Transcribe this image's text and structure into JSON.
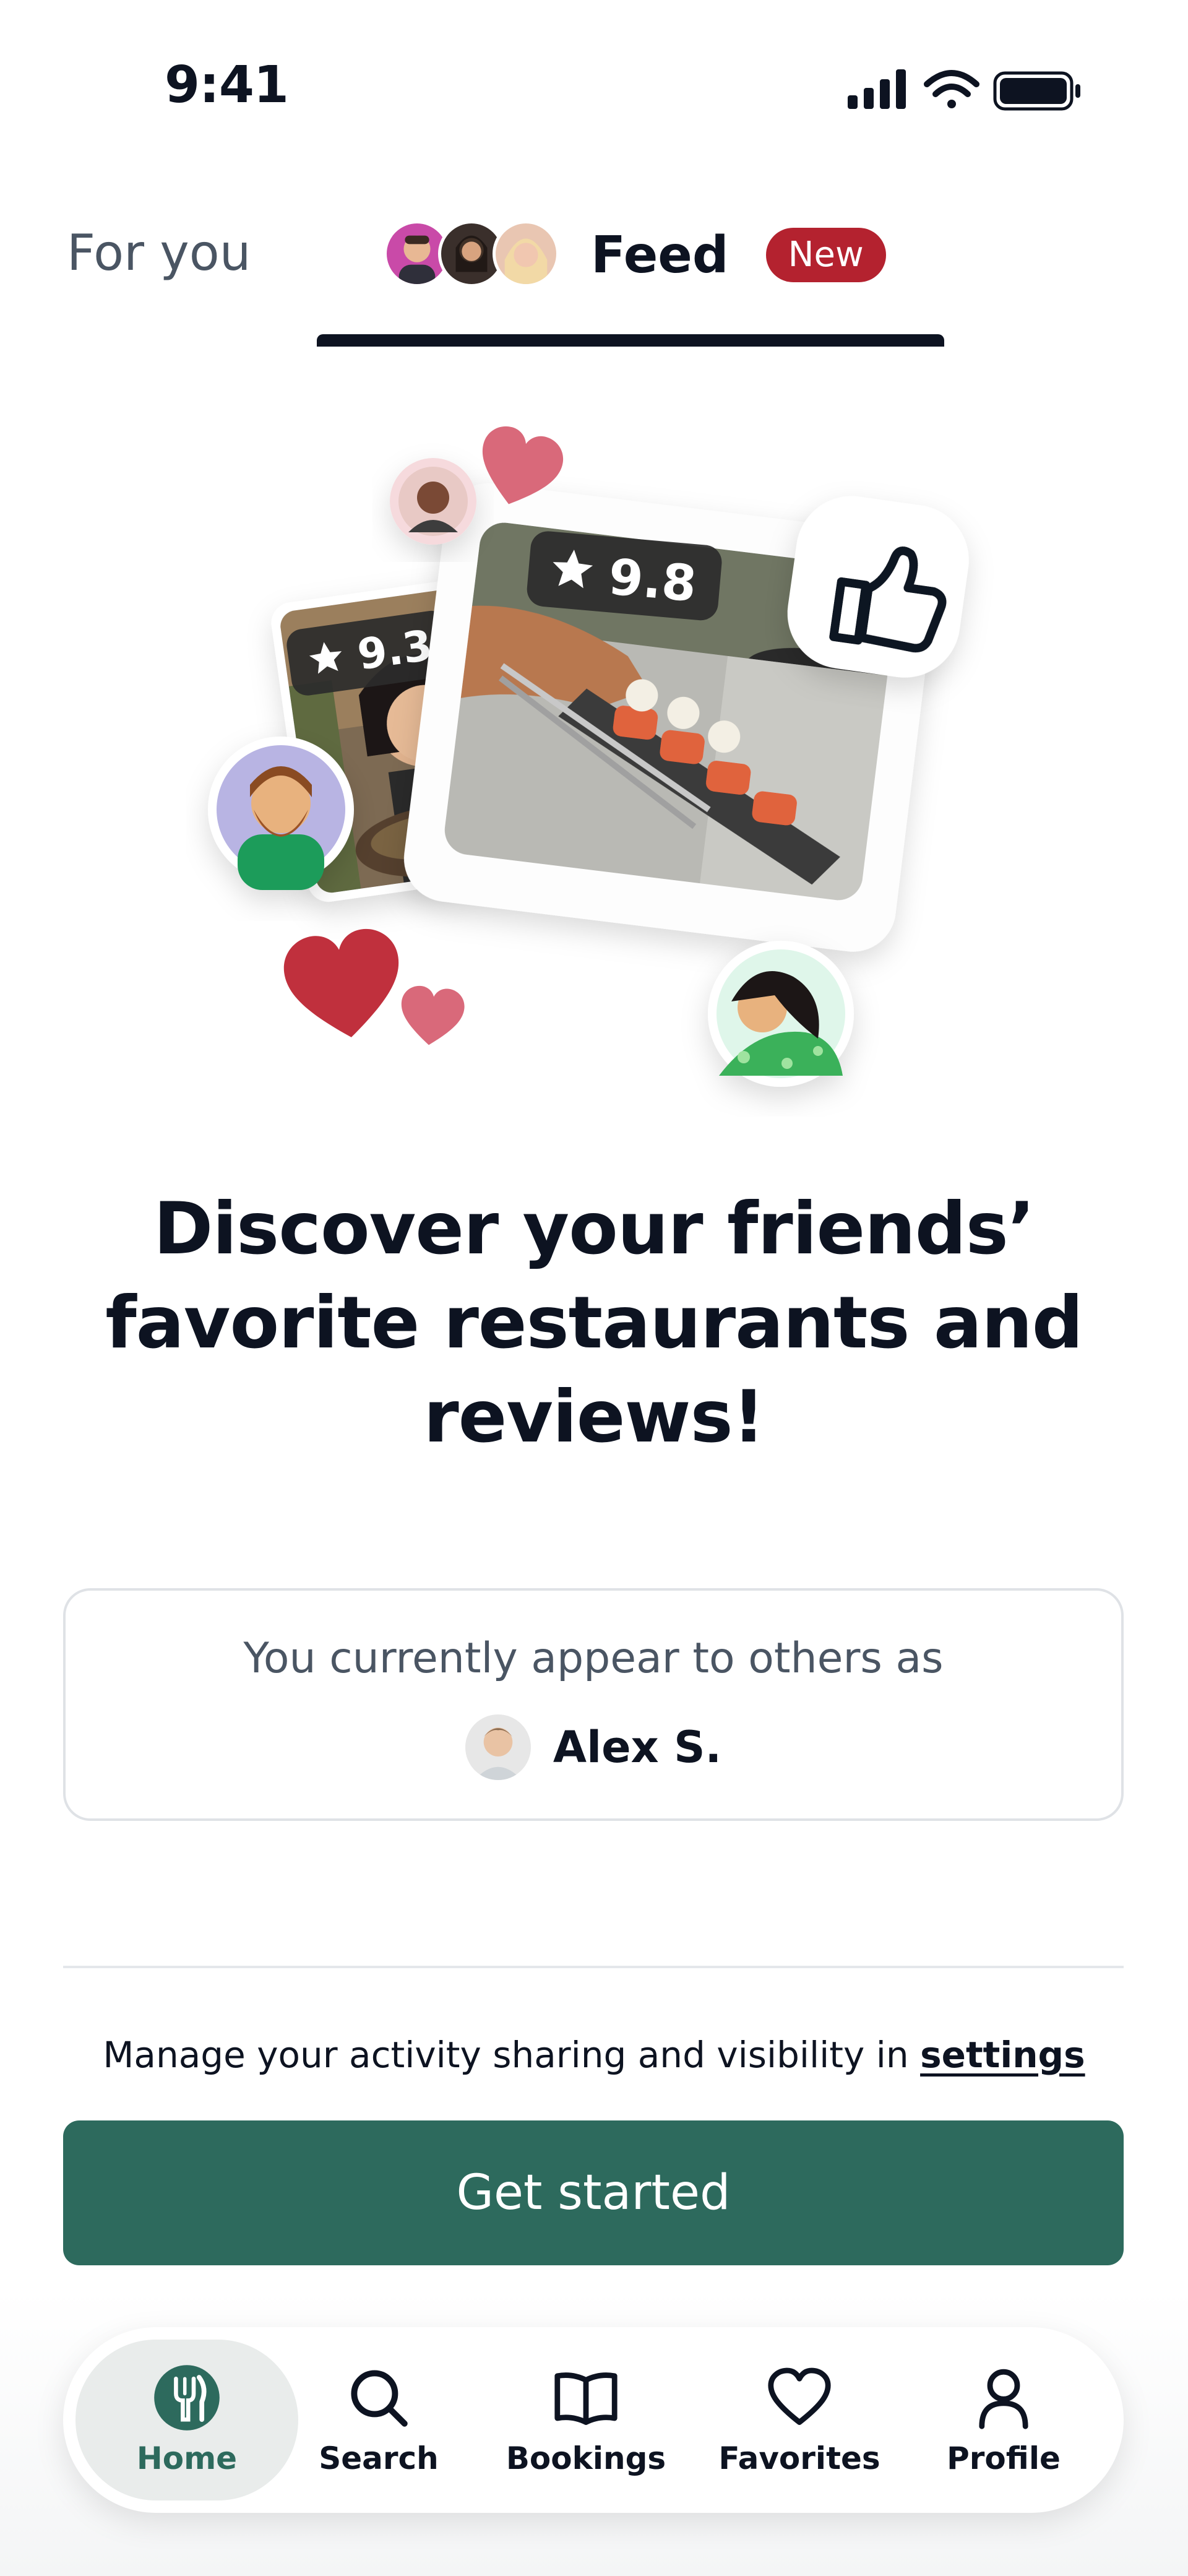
{
  "status_bar": {
    "time": "9:41"
  },
  "tabs": {
    "for_you": "For you",
    "feed": "Feed",
    "feed_badge": "New"
  },
  "hero": {
    "rating_small": "9.3",
    "rating_large": "9.8"
  },
  "headline": "Discover your friends’ favorite restaurants and reviews!",
  "identity": {
    "label": "You currently appear to others as",
    "name": "Alex S."
  },
  "manage": {
    "text": "Manage your activity sharing and visibility in ",
    "link": "settings"
  },
  "cta": {
    "label": "Get started"
  },
  "nav": {
    "items": [
      {
        "label": "Home",
        "icon": "fork-knife-icon",
        "active": true
      },
      {
        "label": "Search",
        "icon": "search-icon"
      },
      {
        "label": "Bookings",
        "icon": "book-icon"
      },
      {
        "label": "Favorites",
        "icon": "heart-icon"
      },
      {
        "label": "Profile",
        "icon": "person-icon"
      }
    ]
  },
  "colors": {
    "accent": "#2d6a5d",
    "badge": "#b4222f",
    "heart": "#c0303d",
    "heart_light": "#d9697a"
  }
}
